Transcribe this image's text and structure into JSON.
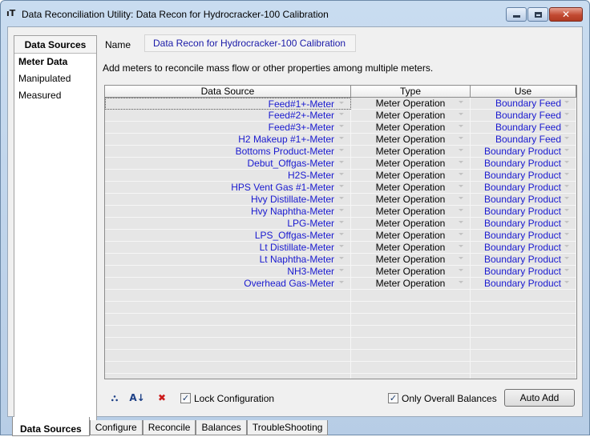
{
  "window": {
    "title": "Data Reconciliation Utility: Data Recon for Hydrocracker-100 Calibration",
    "icon_glyph": "ᵀ"
  },
  "left_panel": {
    "header": "Data Sources",
    "items": [
      "Meter Data",
      "Manipulated",
      "Measured"
    ]
  },
  "name": {
    "label": "Name",
    "value": "Data Recon for Hydrocracker-100 Calibration"
  },
  "instructions": "Add meters to reconcile mass flow or other properties among multiple meters.",
  "grid": {
    "headers": [
      "Data Source",
      "Type",
      "Use"
    ],
    "rows": [
      {
        "source": "Feed#1+-Meter",
        "type": "Meter Operation",
        "use": "Boundary Feed"
      },
      {
        "source": "Feed#2+-Meter",
        "type": "Meter Operation",
        "use": "Boundary Feed"
      },
      {
        "source": "Feed#3+-Meter",
        "type": "Meter Operation",
        "use": "Boundary Feed"
      },
      {
        "source": "H2 Makeup #1+-Meter",
        "type": "Meter Operation",
        "use": "Boundary Feed"
      },
      {
        "source": "Bottoms Product-Meter",
        "type": "Meter Operation",
        "use": "Boundary Product"
      },
      {
        "source": "Debut_Offgas-Meter",
        "type": "Meter Operation",
        "use": "Boundary Product"
      },
      {
        "source": "H2S-Meter",
        "type": "Meter Operation",
        "use": "Boundary Product"
      },
      {
        "source": "HPS Vent Gas #1-Meter",
        "type": "Meter Operation",
        "use": "Boundary Product"
      },
      {
        "source": "Hvy Distillate-Meter",
        "type": "Meter Operation",
        "use": "Boundary Product"
      },
      {
        "source": "Hvy Naphtha-Meter",
        "type": "Meter Operation",
        "use": "Boundary Product"
      },
      {
        "source": "LPG-Meter",
        "type": "Meter Operation",
        "use": "Boundary Product"
      },
      {
        "source": "LPS_Offgas-Meter",
        "type": "Meter Operation",
        "use": "Boundary Product"
      },
      {
        "source": "Lt Distillate-Meter",
        "type": "Meter Operation",
        "use": "Boundary Product"
      },
      {
        "source": "Lt Naphtha-Meter",
        "type": "Meter Operation",
        "use": "Boundary Product"
      },
      {
        "source": "NH3-Meter",
        "type": "Meter Operation",
        "use": "Boundary Product"
      },
      {
        "source": "Overhead Gas-Meter",
        "type": "Meter Operation",
        "use": "Boundary Product"
      },
      {
        "source": "",
        "type": "",
        "use": ""
      },
      {
        "source": "",
        "type": "",
        "use": ""
      },
      {
        "source": "",
        "type": "",
        "use": ""
      },
      {
        "source": "",
        "type": "",
        "use": ""
      },
      {
        "source": "",
        "type": "",
        "use": ""
      },
      {
        "source": "",
        "type": "",
        "use": ""
      },
      {
        "source": "",
        "type": "",
        "use": ""
      },
      {
        "source": "",
        "type": "",
        "use": ""
      }
    ]
  },
  "bottom": {
    "icons": [
      "binoculars-icon",
      "sort-az-icon",
      "delete-icon"
    ],
    "lock_configuration": {
      "label": "Lock Configuration",
      "checked": true
    },
    "only_overall_balances": {
      "label": "Only Overall Balances",
      "checked": true
    },
    "auto_add_label": "Auto Add"
  },
  "tabs": [
    "Data Sources",
    "Configure",
    "Reconcile",
    "Balances",
    "TroubleShooting"
  ],
  "colors": {
    "link_blue": "#1a1ad0",
    "window_frame": "#b9d1ea",
    "close_red": "#c24a32"
  }
}
